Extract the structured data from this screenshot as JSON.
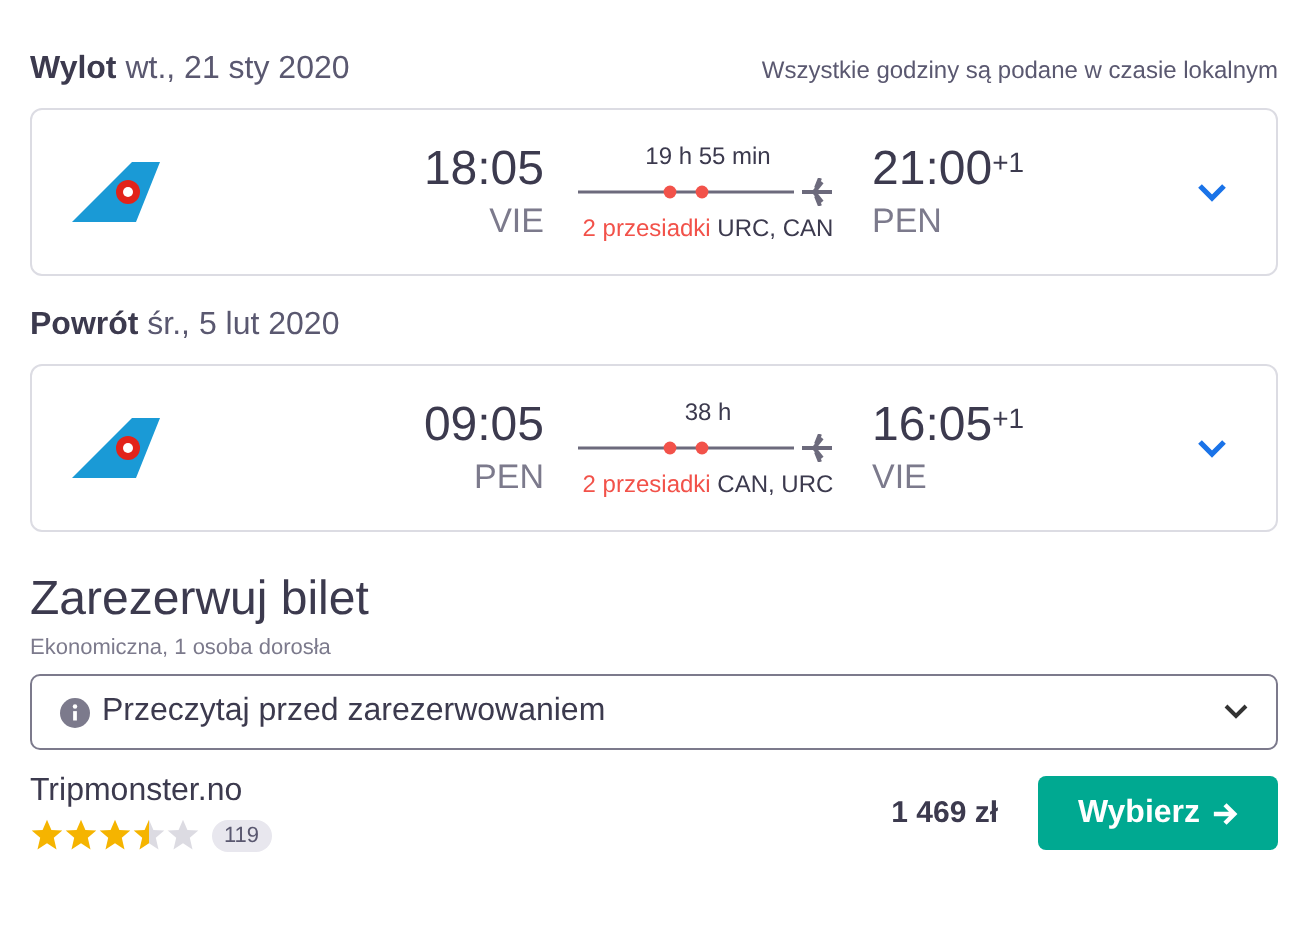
{
  "legs": [
    {
      "label": "Wylot",
      "date": "wt., 21 sty 2020",
      "note": "Wszystkie godziny są podane w czasie lokalnym",
      "depart_time": "18:05",
      "depart_airport": "VIE",
      "duration": "19 h 55 min",
      "arrive_time": "21:00",
      "arrive_offset": "+1",
      "arrive_airport": "PEN",
      "stops_label": "2 przesiadki",
      "stops": "URC, CAN"
    },
    {
      "label": "Powrót",
      "date": "śr., 5 lut 2020",
      "depart_time": "09:05",
      "depart_airport": "PEN",
      "duration": "38 h",
      "arrive_time": "16:05",
      "arrive_offset": "+1",
      "arrive_airport": "VIE",
      "stops_label": "2 przesiadki",
      "stops": "CAN, URC"
    }
  ],
  "booking": {
    "title": "Zarezerwuj bilet",
    "subtitle": "Ekonomiczna, 1 osoba dorosła",
    "info_dropdown": "Przeczytaj przed zarezerwowaniem",
    "expanded": false
  },
  "offer": {
    "provider": "Tripmonster.no",
    "stars": 3.5,
    "reviews": "119",
    "price": "1 469 zł",
    "button": "Wybierz"
  }
}
